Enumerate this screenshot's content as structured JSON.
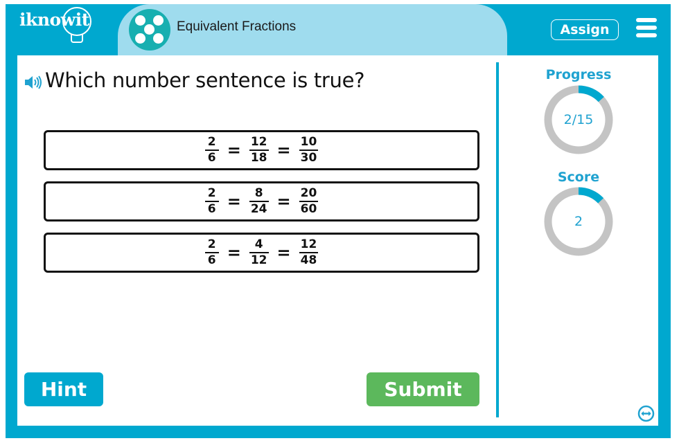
{
  "header": {
    "logo_text": "iknowit",
    "topic_title": "Equivalent Fractions",
    "assign_label": "Assign",
    "menu_icon": "hamburger-menu-icon",
    "topic_icon": "five-dots-icon"
  },
  "question": {
    "audio_icon": "speaker-icon",
    "text": "Which number sentence is true?"
  },
  "options": [
    {
      "fractions": [
        {
          "num": "2",
          "den": "6"
        },
        {
          "num": "12",
          "den": "18"
        },
        {
          "num": "10",
          "den": "30"
        }
      ],
      "operator": "="
    },
    {
      "fractions": [
        {
          "num": "2",
          "den": "6"
        },
        {
          "num": "8",
          "den": "24"
        },
        {
          "num": "20",
          "den": "60"
        }
      ],
      "operator": "="
    },
    {
      "fractions": [
        {
          "num": "2",
          "den": "6"
        },
        {
          "num": "4",
          "den": "12"
        },
        {
          "num": "12",
          "den": "48"
        }
      ],
      "operator": "="
    }
  ],
  "buttons": {
    "hint": "Hint",
    "submit": "Submit"
  },
  "sidebar": {
    "progress_label": "Progress",
    "progress_text": "2/15",
    "progress_value": 2,
    "progress_total": 15,
    "score_label": "Score",
    "score_text": "2",
    "score_fraction": 0.13,
    "expand_icon": "expand-arrows-icon"
  },
  "colors": {
    "primary": "#00a8cf",
    "topic_tab": "#9fdcee",
    "topic_icon": "#17afb0",
    "submit": "#5cb85c",
    "ring_track": "#c4c4c4",
    "ring_fill": "#00a8cf",
    "stat_text": "#1fa2d0"
  }
}
